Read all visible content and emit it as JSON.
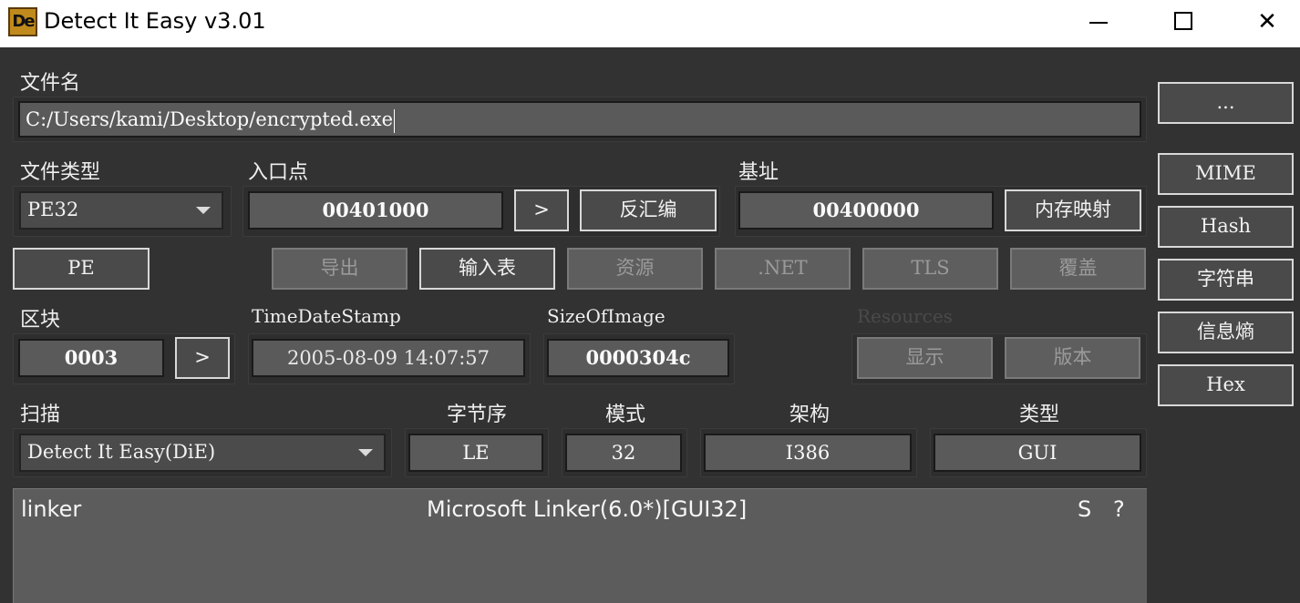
{
  "window": {
    "title": "Detect It Easy v3.01",
    "icon_text": "De",
    "minimize": "minimize-icon",
    "maximize": "maximize-icon",
    "close": "✕"
  },
  "file": {
    "label": "文件名",
    "path": "C:/Users/kami/Desktop/encrypted.exe",
    "browse_label": "..."
  },
  "filetype": {
    "label": "文件类型",
    "value": "PE32"
  },
  "entry": {
    "label": "入口点",
    "value": "00401000",
    "go_label": ">",
    "disasm_label": "反汇编"
  },
  "base": {
    "label": "基址",
    "value": "00400000",
    "memmap_label": "内存映射"
  },
  "pe_button": "PE",
  "tabs": {
    "export": "导出",
    "import": "输入表",
    "resource": "资源",
    "net": ".NET",
    "tls": "TLS",
    "overlay": "覆盖"
  },
  "sections": {
    "label": "区块",
    "value": "0003",
    "go_label": ">"
  },
  "timestamp": {
    "label": "TimeDateStamp",
    "value": "2005-08-09 14:07:57"
  },
  "sizeofimage": {
    "label": "SizeOfImage",
    "value": "0000304c"
  },
  "resources": {
    "label": "Resources",
    "show_label": "显示",
    "version_label": "版本"
  },
  "scan": {
    "label": "扫描",
    "engine": "Detect It Easy(DiE)"
  },
  "endian": {
    "label": "字节序",
    "value": "LE"
  },
  "mode": {
    "label": "模式",
    "value": "32"
  },
  "arch": {
    "label": "架构",
    "value": "I386"
  },
  "type": {
    "label": "类型",
    "value": "GUI"
  },
  "result": {
    "kind": "linker",
    "name": "Microsoft Linker(6.0*)[GUI32]",
    "s_label": "S",
    "q_label": "?"
  },
  "side": {
    "mime": "MIME",
    "hash": "Hash",
    "strings": "字符串",
    "entropy": "信息熵",
    "hex": "Hex"
  }
}
